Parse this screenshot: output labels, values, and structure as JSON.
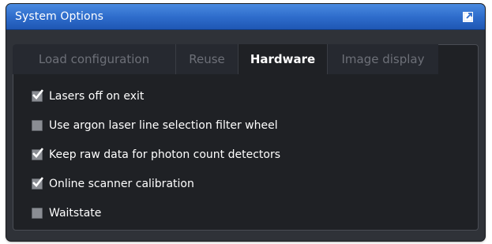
{
  "window": {
    "title": "System Options",
    "undock_icon": "undock-icon"
  },
  "tabs": [
    {
      "label": "Load configuration",
      "active": false
    },
    {
      "label": "Reuse",
      "active": false
    },
    {
      "label": "Hardware",
      "active": true
    },
    {
      "label": "Image display",
      "active": false
    }
  ],
  "options": [
    {
      "label": "Lasers off on exit",
      "checked": true
    },
    {
      "label": "Use argon laser line selection filter wheel",
      "checked": false
    },
    {
      "label": "Keep raw data for photon count detectors",
      "checked": true
    },
    {
      "label": "Online scanner calibration",
      "checked": true
    },
    {
      "label": "Waitstate",
      "checked": false
    }
  ],
  "colors": {
    "titlebar": "#2f6dcc",
    "background": "#2f3238",
    "panel": "#1f2125",
    "active_tab_text": "#ffffff",
    "inactive_tab_text": "#6d7078"
  }
}
